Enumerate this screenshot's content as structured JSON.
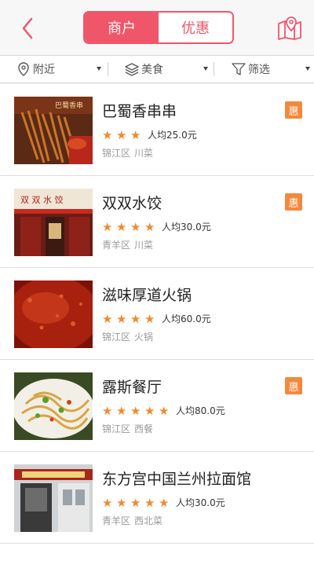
{
  "header": {
    "tabs": [
      {
        "label": "商户",
        "active": true
      },
      {
        "label": "优惠",
        "active": false
      }
    ],
    "back_icon": "chevron-left-icon",
    "map_icon": "map-location-icon",
    "accent_color": "#f0566a"
  },
  "filters": [
    {
      "label": "附近",
      "icon": "location-pin-icon"
    },
    {
      "label": "美食",
      "icon": "layers-icon"
    },
    {
      "label": "筛选",
      "icon": "funnel-icon"
    }
  ],
  "merchants": [
    {
      "name": "巴蜀香串串",
      "stars": 3,
      "price": "人均25.0元",
      "district": "锦江区",
      "cuisine": "川菜",
      "promo": true,
      "promo_label": "惠"
    },
    {
      "name": "双双水饺",
      "stars": 4,
      "price": "人均30.0元",
      "district": "青羊区",
      "cuisine": "川菜",
      "promo": true,
      "promo_label": "惠"
    },
    {
      "name": "滋味厚道火锅",
      "stars": 4,
      "price": "人均60.0元",
      "district": "锦江区",
      "cuisine": "火锅",
      "promo": false,
      "promo_label": ""
    },
    {
      "name": "露斯餐厅",
      "stars": 5,
      "price": "人均80.0元",
      "district": "锦江区",
      "cuisine": "西餐",
      "promo": true,
      "promo_label": "惠"
    },
    {
      "name": "东方宫中国兰州拉面馆",
      "stars": 5,
      "price": "人均30.0元",
      "district": "青羊区",
      "cuisine": "西北菜",
      "promo": false,
      "promo_label": ""
    }
  ],
  "thumb_signs": [
    "巴蜀香串",
    "双 双 水 饺"
  ],
  "star_color": "#f08a2c",
  "promo_color": "#f5883d"
}
